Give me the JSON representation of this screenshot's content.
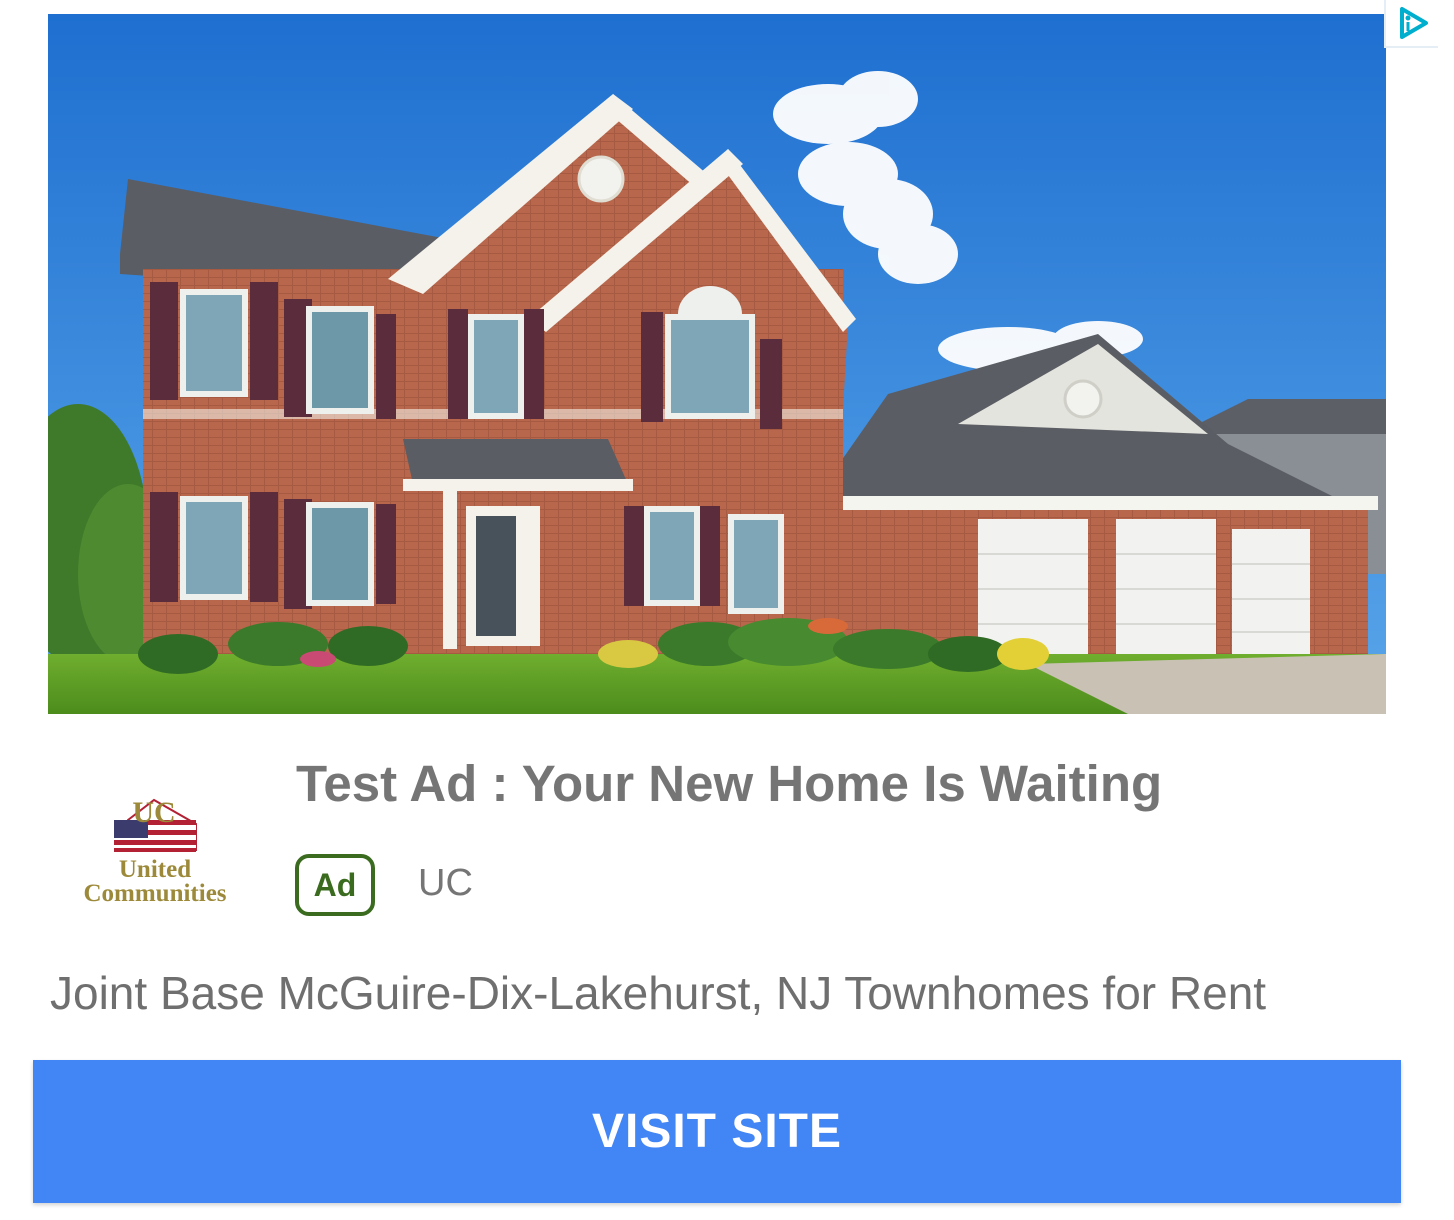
{
  "ad": {
    "headline": "Test Ad : Your New Home Is Waiting",
    "badge_label": "Ad",
    "advertiser": "UC",
    "description": "Joint Base McGuire-Dix-Lakehurst, NJ Townhomes for Rent",
    "cta_label": "VISIT SITE"
  },
  "logo": {
    "brand_line1": "United",
    "brand_line2": "Communities",
    "monogram": "UC"
  },
  "icons": {
    "adchoices": "adchoices-icon"
  },
  "colors": {
    "cta_background": "#4285f4",
    "cta_text": "#ffffff",
    "badge_green": "#3a6b1f",
    "headline_gray": "#757575",
    "logo_gold": "#9c8a3a",
    "adchoices_blue": "#00aecd"
  }
}
